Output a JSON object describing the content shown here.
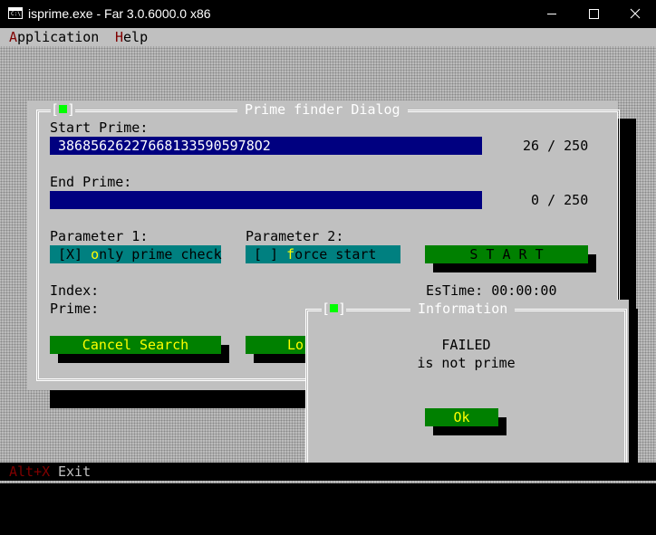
{
  "window": {
    "title": "isprime.exe - Far 3.0.6000.0 x86",
    "icon_text": "C:\\."
  },
  "menu": {
    "items": [
      {
        "hotkey": "A",
        "rest": "pplication"
      },
      {
        "hotkey": "H",
        "rest": "elp"
      }
    ]
  },
  "dialog": {
    "title": "Prime finder Dialog",
    "close_box": "[■]",
    "start_label": "Start Prime:",
    "start_value": "386856262276681335905978O2",
    "start_counter": "26 / 250",
    "end_label": "End Prime:",
    "end_value": "",
    "end_counter": " 0 / 250",
    "param1_label": "Parameter 1:",
    "param1_box": "[X] ",
    "param1_hot": "o",
    "param1_rest": "nly prime check",
    "param2_label": "Parameter 2:",
    "param2_box": "[ ] ",
    "param2_hot": "f",
    "param2_rest": "orce start",
    "start_button": "S T A R T",
    "index_label": "Index:",
    "prime_label": "Prime:",
    "estime_label": "EsTime: 00:00:00",
    "cancel_button": "Cancel Search",
    "log_button_partial": "Lo"
  },
  "info": {
    "title": "Information",
    "line1": "FAILED",
    "line2": "is not prime",
    "ok_button": "Ok"
  },
  "status": {
    "key": "Alt+X",
    "label": "Exit"
  },
  "colors": {
    "console_bg": "#bcbcbc",
    "field_bg": "#000080",
    "checkbox_bg": "#008080",
    "button_bg": "#008000",
    "hotkey": "#ffff00",
    "menu_hotkey": "#800000"
  }
}
